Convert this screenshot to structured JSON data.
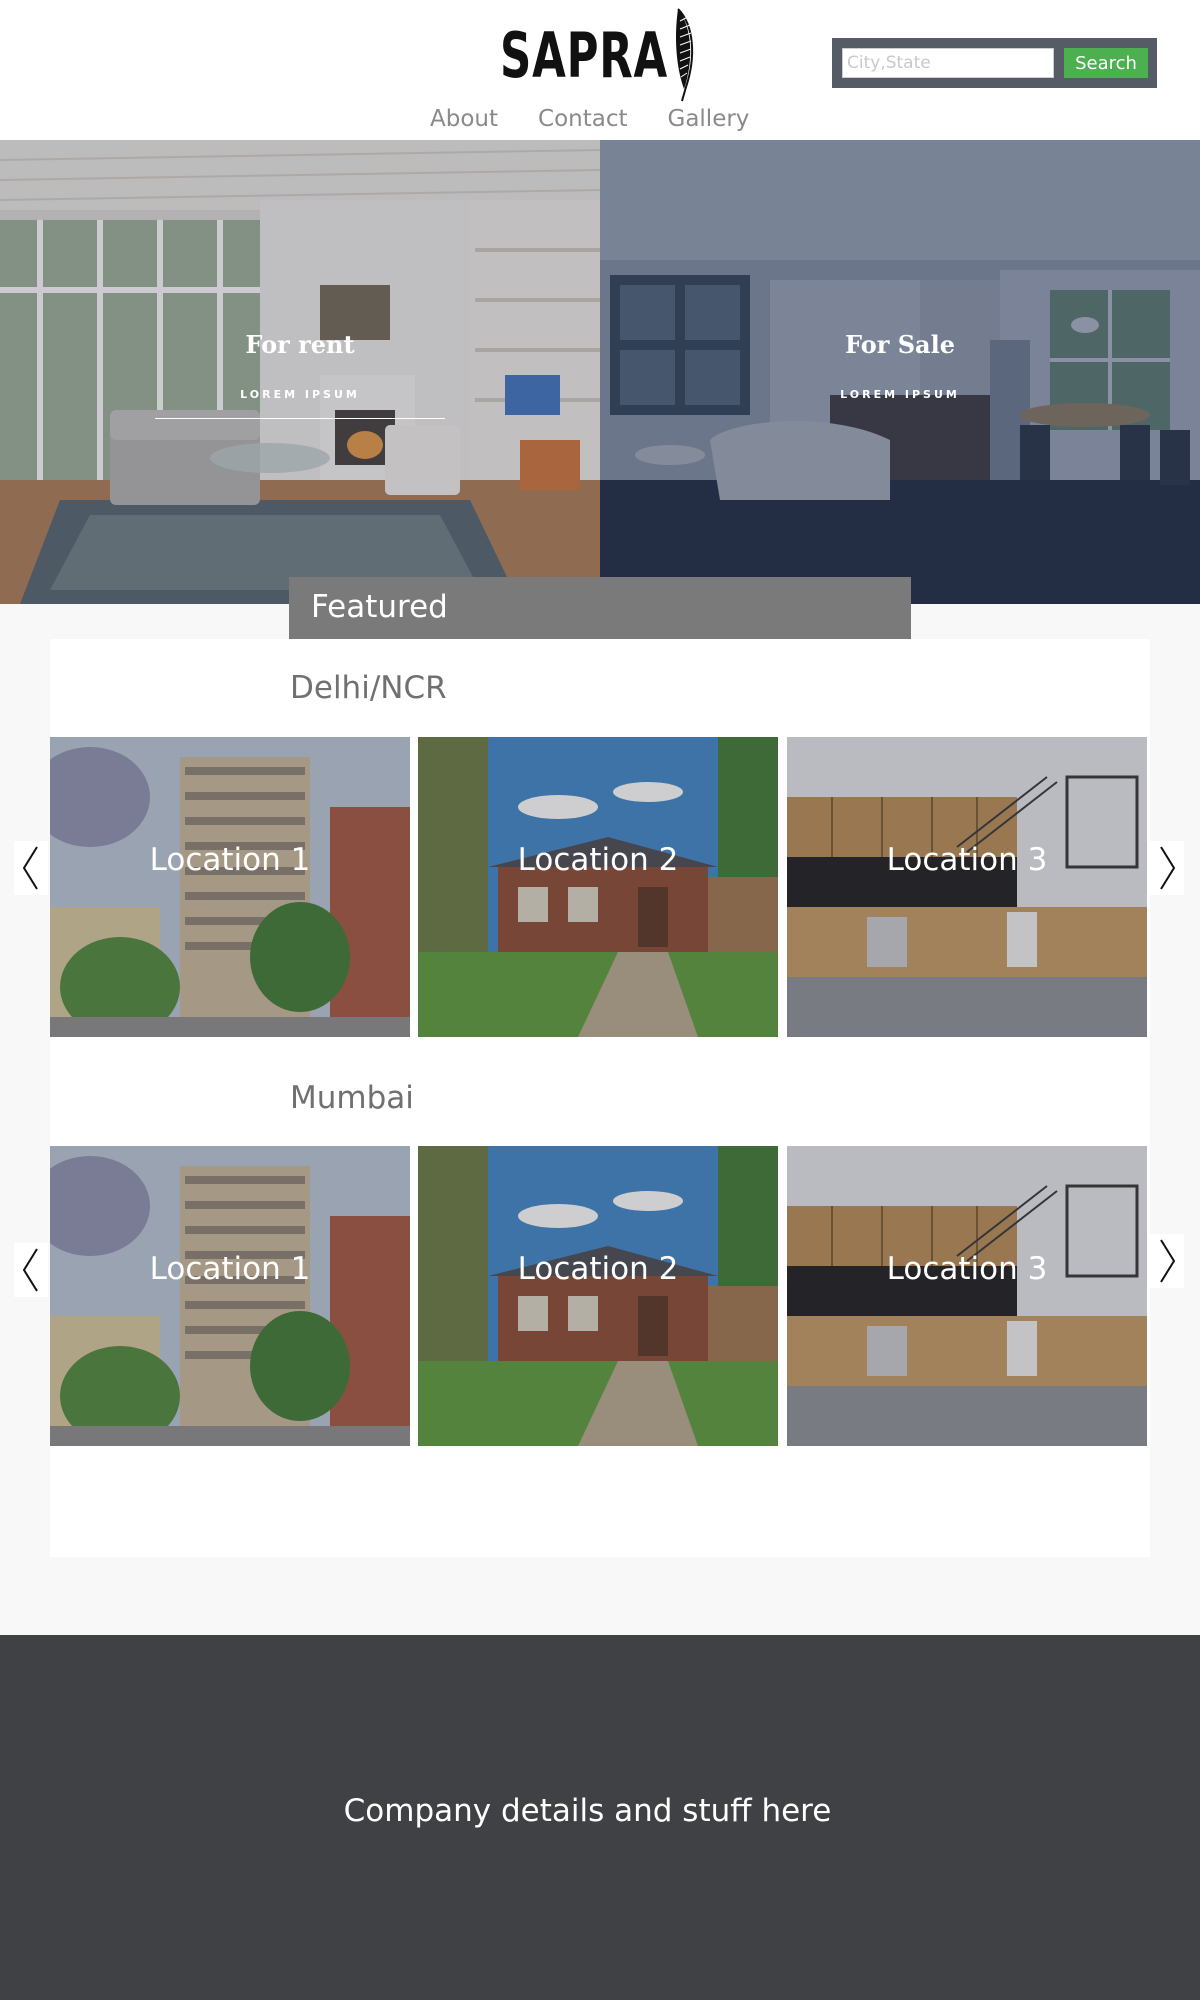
{
  "header": {
    "logo_text": "SAPRA",
    "nav": [
      "About",
      "Contact",
      "Gallery"
    ],
    "search": {
      "placeholder": "City,State",
      "value": "",
      "button_label": "Search"
    }
  },
  "hero": {
    "rent": {
      "title": "For rent",
      "subtitle": "LOREM IPSUM"
    },
    "sale": {
      "title": "For Sale",
      "subtitle": "LOREM IPSUM"
    }
  },
  "featured": {
    "tab_label": "Featured",
    "regions": [
      {
        "name": "Delhi/NCR",
        "locations": [
          "Location 1",
          "Location 2",
          "Location 3"
        ]
      },
      {
        "name": "Mumbai",
        "locations": [
          "Location 1",
          "Location 2",
          "Location 3"
        ]
      }
    ]
  },
  "footer": {
    "text": "Company details and stuff here"
  },
  "colors": {
    "search_bg": "#555c66",
    "search_button": "#4caf50",
    "featured_tab": "#7a7a7a",
    "footer_bg": "#3f4145"
  }
}
